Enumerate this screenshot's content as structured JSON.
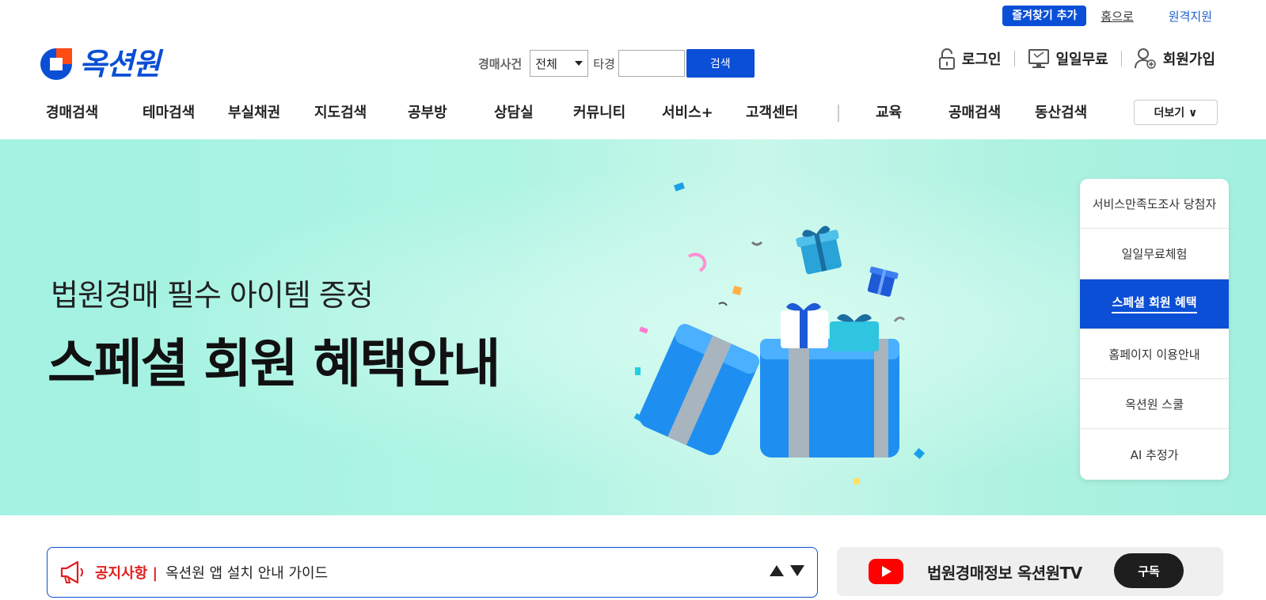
{
  "utility": {
    "favorite": "즐겨찾기 추가",
    "home": "홈으로",
    "remote": "원격지원"
  },
  "logo": {
    "text": "옥션원"
  },
  "search": {
    "label": "경매사건",
    "select_value": "전체",
    "label2": "타경",
    "input_value": "",
    "button": "검색"
  },
  "auth": {
    "login": "로그인",
    "free": "일일무료",
    "signup": "회원가입"
  },
  "nav": {
    "items": [
      "경매검색",
      "테마검색",
      "부실채권",
      "지도검색",
      "공부방",
      "상담실",
      "커뮤니티",
      "서비스+",
      "고객센터",
      "교육",
      "공매검색",
      "동산검색"
    ],
    "more": "더보기 ∨"
  },
  "banner": {
    "subtitle": "법원경매 필수 아이템 증정",
    "title": "스페셜 회원 혜택안내",
    "bg_color": "#a3f2e2"
  },
  "side_menu": {
    "items": [
      "서비스만족도조사 당첨자",
      "일일무료체험",
      "스페셜 회원 혜택",
      "홈페이지 이용안내",
      "옥션원 스쿨",
      "AI 추정가"
    ],
    "active_index": 2
  },
  "notice": {
    "label": "공지사항 |",
    "text": "옥션원 앱 설치 안내 가이드"
  },
  "youtube": {
    "text": "법원경매정보 옥션원TV",
    "subscribe": "구독"
  },
  "colors": {
    "accent": "#0b4fd6",
    "notice_red": "#e01f1f",
    "youtube_red": "#ff0000"
  }
}
